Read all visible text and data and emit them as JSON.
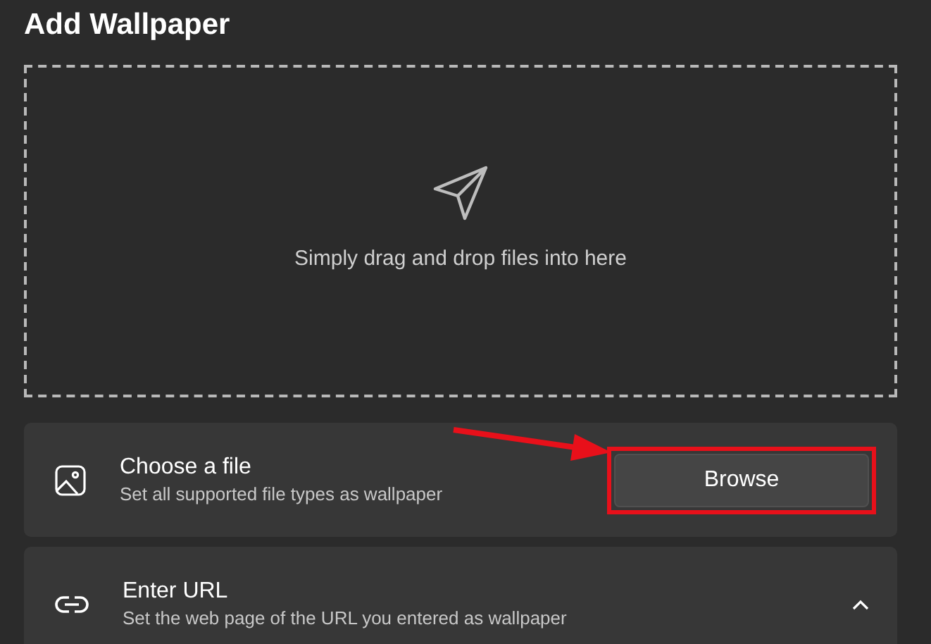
{
  "title": "Add Wallpaper",
  "dropzone": {
    "text": "Simply drag and drop files into here"
  },
  "cards": [
    {
      "kind": "button",
      "title": "Choose a file",
      "subtitle": "Set all supported file types as wallpaper",
      "button": "Browse",
      "highlighted": true
    },
    {
      "kind": "expander",
      "title": "Enter URL",
      "subtitle": "Set the web page of the URL you entered as wallpaper",
      "expanded": true
    }
  ]
}
